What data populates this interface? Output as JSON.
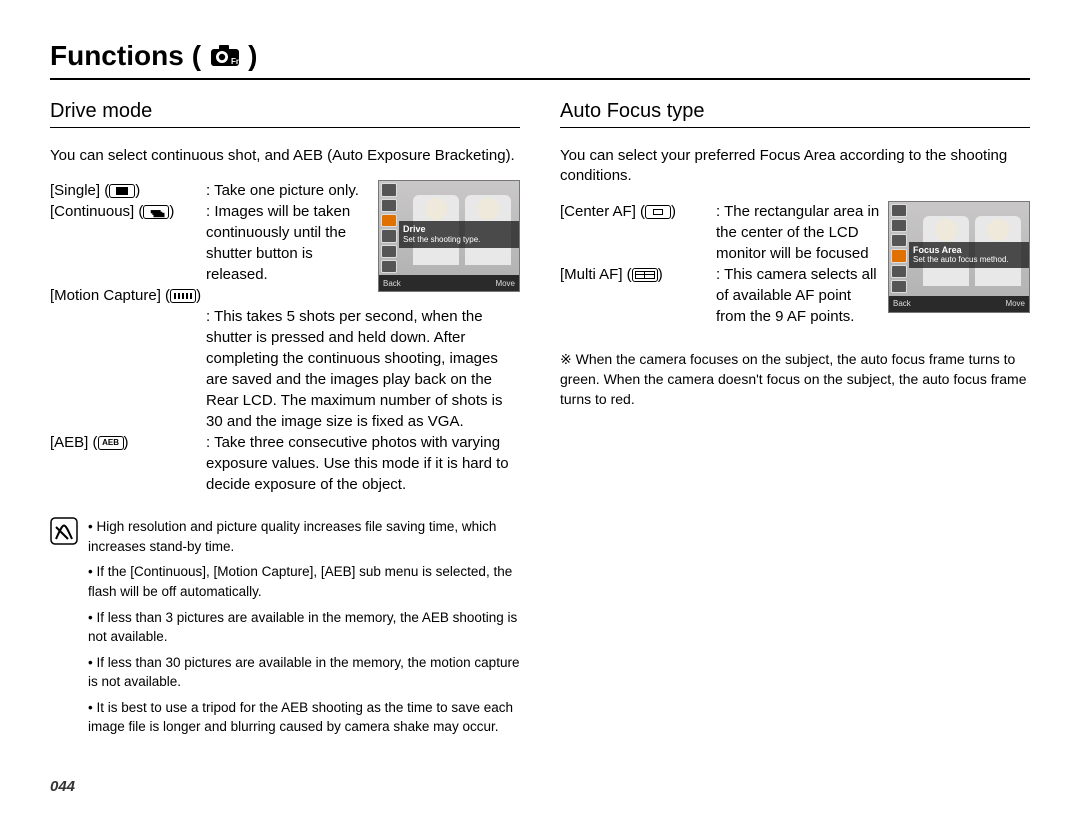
{
  "page_title": "Functions",
  "page_number": "044",
  "left": {
    "heading": "Drive mode",
    "lead": "You can select continuous shot, and AEB (Auto Exposure Bracketing).",
    "items": {
      "single_label": "[Single]",
      "single_desc": "Take one picture only.",
      "continuous_label": "[Continuous]",
      "continuous_desc": "Images will be taken continuously until the shutter button is released.",
      "motion_label": "[Motion Capture]",
      "motion_desc": "This takes 5 shots per second, when the shutter is pressed and held down. After completing the continuous shooting, images are saved and the images play back on the Rear LCD. The maximum number of shots is 30 and the image size is fixed as VGA.",
      "aeb_label": "[AEB]",
      "aeb_desc": "Take three consecutive photos with varying exposure values. Use this mode if it is hard to decide exposure of the object."
    },
    "notes": [
      "High resolution and picture quality increases file saving time, which increases stand-by time.",
      "If the [Continuous], [Motion Capture], [AEB] sub menu is selected, the flash will be off automatically.",
      "If less than 3 pictures are available in the memory, the AEB shooting is not available.",
      "If less than 30 pictures are available in the memory, the motion capture is not available.",
      "It is best to use a tripod for the AEB shooting as the time to save each image file is longer and blurring caused by camera shake may occur."
    ],
    "lcd": {
      "title": "Drive",
      "subtitle": "Set the shooting type.",
      "back_label": "Back",
      "move_label": "Move"
    }
  },
  "right": {
    "heading": "Auto Focus type",
    "lead": "You can select your preferred Focus Area according to the shooting conditions.",
    "items": {
      "center_label": "[Center AF]",
      "center_desc": "The rectangular area in the center of the LCD monitor will be focused",
      "multi_label": "[Multi AF]",
      "multi_desc": "This camera selects all of available AF point from the 9 AF points."
    },
    "note": "※ When the camera focuses on the subject, the auto focus frame turns to green. When the camera doesn't focus on the subject, the auto focus frame turns to red.",
    "lcd": {
      "title": "Focus Area",
      "subtitle": "Set the auto focus method.",
      "back_label": "Back",
      "move_label": "Move"
    }
  }
}
